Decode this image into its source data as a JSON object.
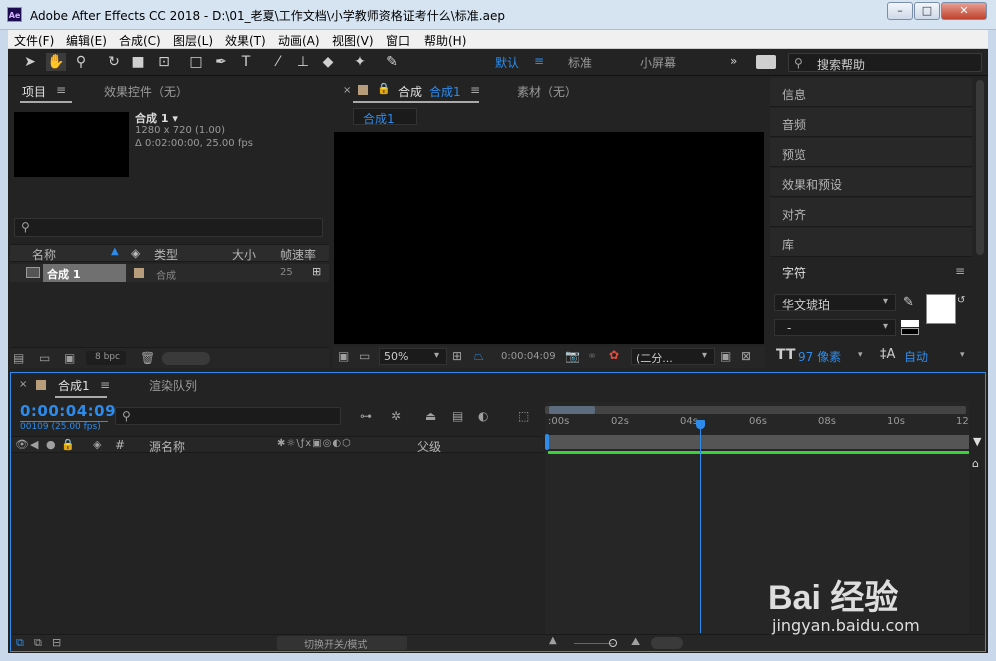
{
  "window": {
    "app_badge": "Ae",
    "title": "Adobe After Effects CC 2018 - D:\\01_老夏\\工作文档\\小学教师资格证考什么\\标准.aep",
    "minimize": "–",
    "maximize": "□",
    "close": "✕"
  },
  "menus": [
    "文件(F)",
    "编辑(E)",
    "合成(C)",
    "图层(L)",
    "效果(T)",
    "动画(A)",
    "视图(V)",
    "窗口",
    "帮助(H)"
  ],
  "toolbar": {
    "workspaces": [
      "默认",
      "标准",
      "小屏幕"
    ],
    "more": "»",
    "search_placeholder": "搜索帮助"
  },
  "project_panel": {
    "tab_project": "项目",
    "tab_effects": "效果控件（无）",
    "comp_name": "合成 1 ▾",
    "comp_size": "1280 x 720 (1.00)",
    "comp_duration": "Δ 0:02:00:00, 25.00 fps",
    "columns": [
      "名称",
      "类型",
      "大小",
      "帧速率"
    ],
    "rows": [
      {
        "name": "合成 1",
        "type": "合成",
        "size": "",
        "fps": "25"
      }
    ],
    "bpc": "8 bpc"
  },
  "comp_panel": {
    "tab_label": "合成",
    "tab_comp_name": "合成1",
    "footage_tab": "素材（无）",
    "breadcrumb": "合成1",
    "zoom": "50%",
    "timecode": "0:00:04:09",
    "resolution": "(二分...",
    "zoom_arrow": "▾"
  },
  "right_panels": {
    "items": [
      "信息",
      "音频",
      "预览",
      "效果和预设",
      "对齐",
      "库"
    ],
    "character_title": "字符",
    "font_name": "华文琥珀",
    "font_style": "-",
    "font_size": "97 像素",
    "leading": "自动"
  },
  "timeline": {
    "tab_comp": "合成1",
    "tab_render": "渲染队列",
    "timecode": "0:00:04:09",
    "frame_info": "00109 (25.00 fps)",
    "columns": {
      "num": "#",
      "source_name": "源名称",
      "parent": "父级"
    },
    "ruler": [
      ":00s",
      "02s",
      "04s",
      "06s",
      "08s",
      "10s",
      "12"
    ],
    "toggle_label": "切换开关/模式"
  },
  "watermark": {
    "brand": "Bai 经验",
    "url": "jingyan.baidu.com"
  }
}
